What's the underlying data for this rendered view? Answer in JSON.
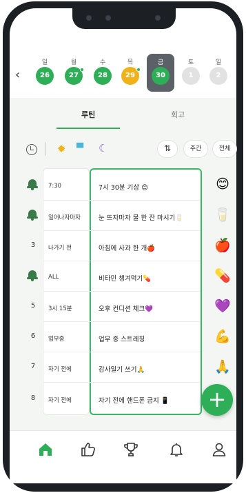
{
  "week": {
    "days": [
      {
        "label": "일",
        "date": "26",
        "color": "#2fae58",
        "dot": false
      },
      {
        "label": "월",
        "date": "27",
        "color": "#2fae58",
        "dot": true
      },
      {
        "label": "수",
        "date": "28",
        "color": "#2fae58",
        "dot": false
      },
      {
        "label": "목",
        "date": "29",
        "color": "#f0b21a",
        "dot": true
      },
      {
        "label": "금",
        "date": "30",
        "color": "#2fae58",
        "dot": false,
        "selected": true
      },
      {
        "label": "토",
        "date": "1",
        "color": "#e2e2e2",
        "dot": false
      },
      {
        "label": "일",
        "date": "2",
        "color": "#e2e2e2",
        "dot": false
      }
    ],
    "prev_icon": "chevron-left-icon"
  },
  "tabs": {
    "routine": "루틴",
    "record": "회고"
  },
  "filters": {
    "sort_icon": "sort-arrows-icon",
    "weekly": "주간",
    "all": "전체"
  },
  "rows": [
    {
      "marker": "bell",
      "time": "7:30",
      "task": "7시 30분 기상 😊",
      "emoji": "😊"
    },
    {
      "marker": "bell",
      "time": "일어나자마자",
      "task": "눈 뜨자마자 물 한 잔 마시기🥛",
      "emoji": "🥛"
    },
    {
      "marker": "3",
      "time": "나가기 전",
      "task": "아침에 사과 한 개🍎",
      "emoji": "🍎"
    },
    {
      "marker": "bell",
      "time": "ALL",
      "task": "비타민 챙겨먹기💊",
      "emoji": "💊"
    },
    {
      "marker": "5",
      "time": "3시 15분",
      "task": "오후 컨디션 체크💜",
      "emoji": "💜"
    },
    {
      "marker": "6",
      "time": "업무중",
      "task": "업무 중 스트레칭",
      "emoji": "💪"
    },
    {
      "marker": "7",
      "time": "자기 전에",
      "task": "감사일기 쓰기🙏",
      "emoji": "🙏"
    },
    {
      "marker": "8",
      "time": "자기 전에",
      "task": "자기 전에 핸드폰 금지 📱",
      "emoji": ""
    }
  ],
  "fab": {
    "label": "+"
  },
  "nav": [
    "home-icon",
    "thumbs-up-icon",
    "trophy-icon",
    "bell-icon",
    "profile-icon"
  ],
  "colors": {
    "accent": "#2fae58",
    "accent_dark": "#3a7a49",
    "highlight_border": "#37b865"
  }
}
